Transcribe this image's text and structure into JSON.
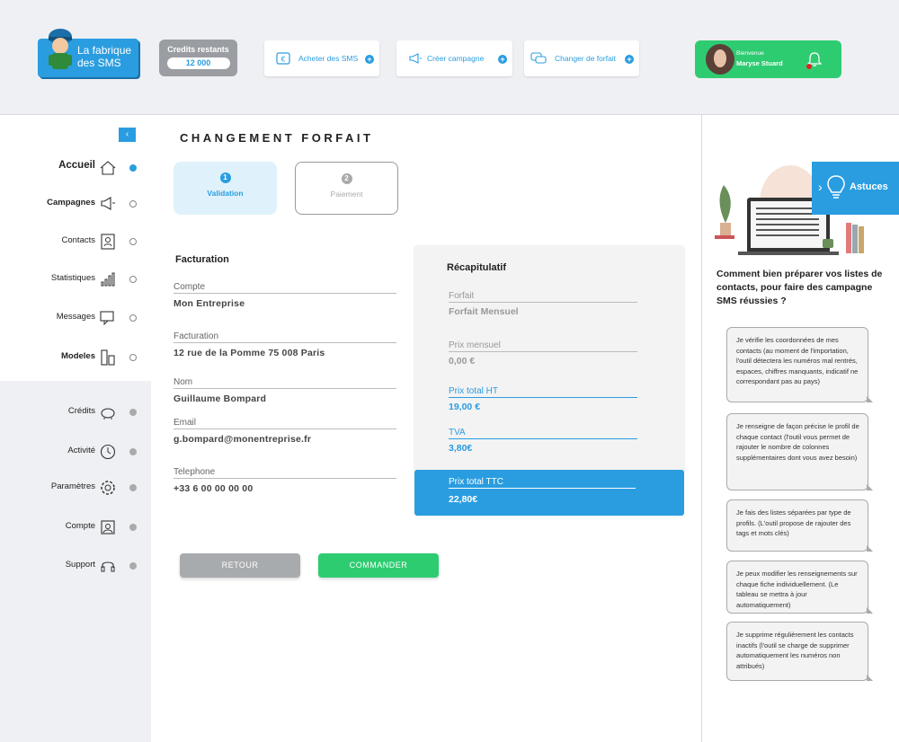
{
  "header": {
    "logo_line1": "La fabrique",
    "logo_line2": "des SMS",
    "credits_label": "Credits restants",
    "credits_value": "12 000",
    "actions": [
      {
        "label": "Acheter des SMS",
        "icon": "euro-card-icon"
      },
      {
        "label": "Créer campagne",
        "icon": "megaphone-icon"
      },
      {
        "label": "Changer de forfait",
        "icon": "chat-bubbles-icon"
      }
    ],
    "user": {
      "greeting": "Bienvenue",
      "name": "Maryse Stuard"
    }
  },
  "sidebar": {
    "items": [
      {
        "label": "Accueil",
        "icon": "home-icon"
      },
      {
        "label": "Campagnes",
        "icon": "megaphone-icon"
      },
      {
        "label": "Contacts",
        "icon": "contact-card-icon"
      },
      {
        "label": "Statistiques",
        "icon": "bar-chart-icon"
      },
      {
        "label": "Messages",
        "icon": "chat-icon"
      },
      {
        "label": "Modeles",
        "icon": "templates-icon"
      },
      {
        "label": "Crédits",
        "icon": "piggy-bank-icon"
      },
      {
        "label": "Activité",
        "icon": "clock-icon"
      },
      {
        "label": "Paramètres",
        "icon": "gear-icon"
      },
      {
        "label": "Compte",
        "icon": "user-icon"
      },
      {
        "label": "Support",
        "icon": "headset-icon"
      }
    ]
  },
  "main": {
    "title": "CHANGEMENT FORFAIT",
    "steps": [
      {
        "num": "1",
        "label": "Validation"
      },
      {
        "num": "2",
        "label": "Paiement"
      }
    ],
    "billing": {
      "title": "Facturation",
      "fields": [
        {
          "label": "Compte",
          "value": "Mon Entreprise"
        },
        {
          "label": "Facturation",
          "value": "12 rue de la Pomme 75 008 Paris"
        },
        {
          "label": "Nom",
          "value": "Guillaume Bompard"
        },
        {
          "label": "Email",
          "value": "g.bompard@monentreprise.fr"
        },
        {
          "label": "Telephone",
          "value": "+33 6 00 00 00 00"
        }
      ]
    },
    "recap": {
      "title": "Récapitulatif",
      "fields": [
        {
          "label": "Forfait",
          "value": "Forfait Mensuel"
        },
        {
          "label": "Prix mensuel",
          "value": "0,00 €"
        },
        {
          "label": "Prix total  HT",
          "value": "19,00 €"
        },
        {
          "label": "TVA",
          "value": "3,80€"
        }
      ],
      "total_label": "Prix total TTC",
      "total_value": "22,80€"
    },
    "buttons": {
      "back": "RETOUR",
      "order": "COMMANDER"
    }
  },
  "tips": {
    "astuces_label": "Astuces",
    "heading": "Comment bien préparer vos listes de contacts, pour faire des campagne SMS réussies ?",
    "items": [
      {
        "text": "Je vérifie les coordonnées de mes contacts (au moment de l'importation, l'outil détectera les numéros mal rentrés, espaces, chiffres manquants, indicatif ne correspondant pas au pays)"
      },
      {
        "text": "Je renseigne de façon précise le profil de chaque contact (l'outil vous permet de rajouter le nombre de colonnes supplémentaires dont vous avez besoin)"
      },
      {
        "text": "Je fais des listes séparées par type de profils. (L'outil propose de rajouter des tags et mots clés)"
      },
      {
        "text": "Je peux modifier les renseignements sur chaque fiche individuellement. (Le tableau se mettra à jour automatiquement)"
      },
      {
        "text": "Je supprime régulièrement les contacts inactifs (l'outil se charge de supprimer automatiquement les numéros non attribués)"
      }
    ]
  },
  "colors": {
    "accent": "#2a9de0",
    "success": "#2ecc71",
    "muted": "#a8abae"
  }
}
